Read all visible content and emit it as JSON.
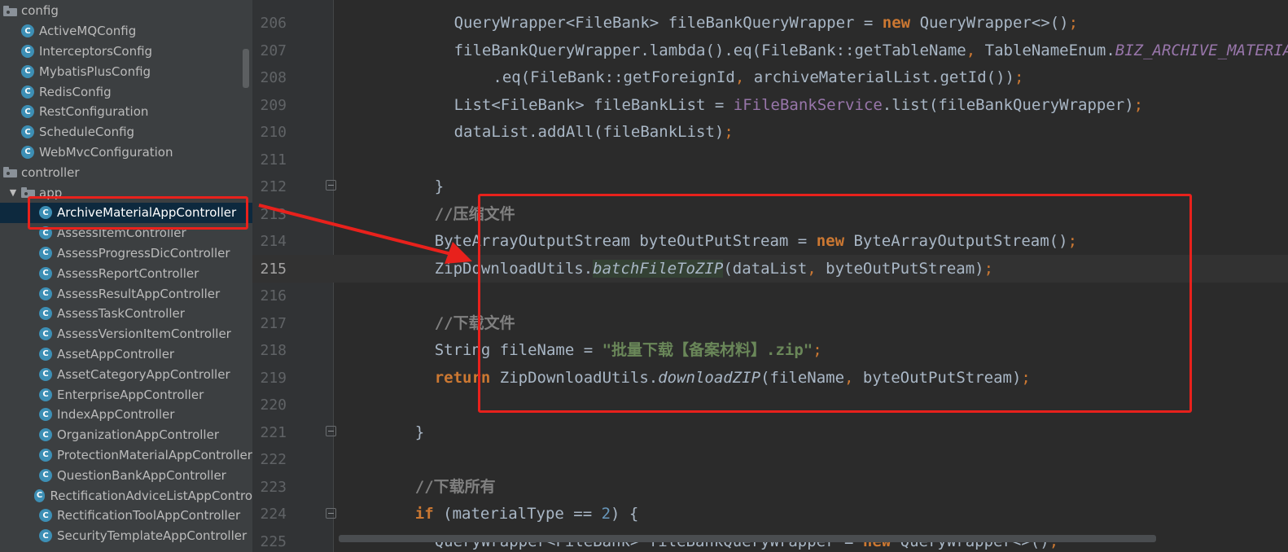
{
  "sidebar": {
    "items": [
      {
        "label": "config",
        "kind": "folder",
        "indent": 0
      },
      {
        "label": "ActiveMQConfig",
        "kind": "class",
        "indent": 1
      },
      {
        "label": "InterceptorsConfig",
        "kind": "class",
        "indent": 1
      },
      {
        "label": "MybatisPlusConfig",
        "kind": "class",
        "indent": 1
      },
      {
        "label": "RedisConfig",
        "kind": "class",
        "indent": 1
      },
      {
        "label": "RestConfiguration",
        "kind": "class",
        "indent": 1
      },
      {
        "label": "ScheduleConfig",
        "kind": "class",
        "indent": 1
      },
      {
        "label": "WebMvcConfiguration",
        "kind": "class",
        "indent": 1
      },
      {
        "label": "controller",
        "kind": "folder",
        "indent": 0
      },
      {
        "label": "app",
        "kind": "folder",
        "indent": 1,
        "expanded": true
      },
      {
        "label": "ArchiveMaterialAppController",
        "kind": "class",
        "indent": 2,
        "selected": true
      },
      {
        "label": "AssessItemController",
        "kind": "class",
        "indent": 2
      },
      {
        "label": "AssessProgressDicController",
        "kind": "class",
        "indent": 2
      },
      {
        "label": "AssessReportController",
        "kind": "class",
        "indent": 2
      },
      {
        "label": "AssessResultAppController",
        "kind": "class",
        "indent": 2
      },
      {
        "label": "AssessTaskController",
        "kind": "class",
        "indent": 2
      },
      {
        "label": "AssessVersionItemController",
        "kind": "class",
        "indent": 2
      },
      {
        "label": "AssetAppController",
        "kind": "class",
        "indent": 2
      },
      {
        "label": "AssetCategoryAppController",
        "kind": "class",
        "indent": 2
      },
      {
        "label": "EnterpriseAppController",
        "kind": "class",
        "indent": 2
      },
      {
        "label": "IndexAppController",
        "kind": "class",
        "indent": 2
      },
      {
        "label": "OrganizationAppController",
        "kind": "class",
        "indent": 2
      },
      {
        "label": "ProtectionMaterialAppController",
        "kind": "class",
        "indent": 2
      },
      {
        "label": "QuestionBankAppController",
        "kind": "class",
        "indent": 2
      },
      {
        "label": "RectificationAdviceListAppContro",
        "kind": "class",
        "indent": 2
      },
      {
        "label": "RectificationToolAppController",
        "kind": "class",
        "indent": 2
      },
      {
        "label": "SecurityTemplateAppController",
        "kind": "class",
        "indent": 2
      }
    ],
    "class_icon_letter": "C",
    "expand_arrow": "▼"
  },
  "editor": {
    "active_line": "215",
    "lines": [
      {
        "no": "206",
        "indent": 8,
        "tokens": [
          {
            "t": "QueryWrapper<FileBank> fileBankQueryWrapper = "
          },
          {
            "t": "new",
            "c": "kw"
          },
          {
            "t": " QueryWrapper<>()"
          },
          {
            "t": ";",
            "c": "punct"
          }
        ]
      },
      {
        "no": "207",
        "indent": 8,
        "tokens": [
          {
            "t": "fileBankQueryWrapper.lambda().eq(FileBank::getTableName"
          },
          {
            "t": ",",
            "c": "punct"
          },
          {
            "t": " TableNameEnum."
          },
          {
            "t": "BIZ_ARCHIVE_MATERIAL",
            "c": "purple-italic"
          }
        ]
      },
      {
        "no": "208",
        "indent": 12,
        "tokens": [
          {
            "t": ".eq(FileBank::getForeignId"
          },
          {
            "t": ",",
            "c": "punct"
          },
          {
            "t": " archiveMaterialList.getId())"
          },
          {
            "t": ";",
            "c": "punct"
          }
        ]
      },
      {
        "no": "209",
        "indent": 8,
        "tokens": [
          {
            "t": "List<FileBank> fileBankList = "
          },
          {
            "t": "iFileBankService",
            "c": "purple"
          },
          {
            "t": ".list(fileBankQueryWrapper)"
          },
          {
            "t": ";",
            "c": "punct"
          }
        ]
      },
      {
        "no": "210",
        "indent": 8,
        "tokens": [
          {
            "t": "dataList.addAll(fileBankList)"
          },
          {
            "t": ";",
            "c": "punct"
          }
        ]
      },
      {
        "no": "211",
        "indent": 0,
        "tokens": []
      },
      {
        "no": "212",
        "indent": 6,
        "tokens": [
          {
            "t": "}"
          }
        ]
      },
      {
        "no": "213",
        "indent": 6,
        "tokens": [
          {
            "t": "//压缩文件",
            "c": "comment"
          }
        ]
      },
      {
        "no": "214",
        "indent": 6,
        "tokens": [
          {
            "t": "ByteArrayOutputStream byteOutPutStream = "
          },
          {
            "t": "new",
            "c": "kw"
          },
          {
            "t": " ByteArrayOutputStream()"
          },
          {
            "t": ";",
            "c": "punct"
          }
        ]
      },
      {
        "no": "215",
        "indent": 6,
        "tokens": [
          {
            "t": "ZipDownloadUtils."
          },
          {
            "t": "batchFileToZIP",
            "c": "method-hl"
          },
          {
            "t": "(dataList"
          },
          {
            "t": ",",
            "c": "punct"
          },
          {
            "t": " byteOutPutStream)"
          },
          {
            "t": ";",
            "c": "punct"
          }
        ]
      },
      {
        "no": "216",
        "indent": 0,
        "tokens": []
      },
      {
        "no": "217",
        "indent": 6,
        "tokens": [
          {
            "t": "//下载文件",
            "c": "comment"
          }
        ]
      },
      {
        "no": "218",
        "indent": 6,
        "tokens": [
          {
            "t": "String fileName = "
          },
          {
            "t": "\"批量下载【备案材料】.zip\"",
            "c": "string"
          },
          {
            "t": ";",
            "c": "punct"
          }
        ]
      },
      {
        "no": "219",
        "indent": 6,
        "tokens": [
          {
            "t": "return",
            "c": "kw"
          },
          {
            "t": " ZipDownloadUtils."
          },
          {
            "t": "downloadZIP",
            "c": "method-static"
          },
          {
            "t": "(fileName"
          },
          {
            "t": ",",
            "c": "punct"
          },
          {
            "t": " byteOutPutStream)"
          },
          {
            "t": ";",
            "c": "punct"
          }
        ]
      },
      {
        "no": "220",
        "indent": 0,
        "tokens": []
      },
      {
        "no": "221",
        "indent": 4,
        "tokens": [
          {
            "t": "}"
          }
        ]
      },
      {
        "no": "222",
        "indent": 0,
        "tokens": []
      },
      {
        "no": "223",
        "indent": 4,
        "tokens": [
          {
            "t": "//下载所有",
            "c": "comment"
          }
        ]
      },
      {
        "no": "224",
        "indent": 4,
        "tokens": [
          {
            "t": "if",
            "c": "kw"
          },
          {
            "t": " (materialType == "
          },
          {
            "t": "2",
            "c": "num"
          },
          {
            "t": ") {"
          }
        ]
      },
      {
        "no": "225",
        "indent": 6,
        "tokens": [
          {
            "t": "QueryWrapper<FileBank> fileBankQueryWrapper = "
          },
          {
            "t": "new",
            "c": "kw"
          },
          {
            "t": " QueryWrapper<>()"
          },
          {
            "t": ";",
            "c": "punct"
          }
        ]
      }
    ]
  },
  "colors": {
    "highlight_box": "#e8211c",
    "keyword": "#cc7832",
    "comment": "#808080",
    "string": "#6a8759",
    "field": "#9876aa",
    "number": "#6897bb",
    "selection": "#0d293e"
  }
}
